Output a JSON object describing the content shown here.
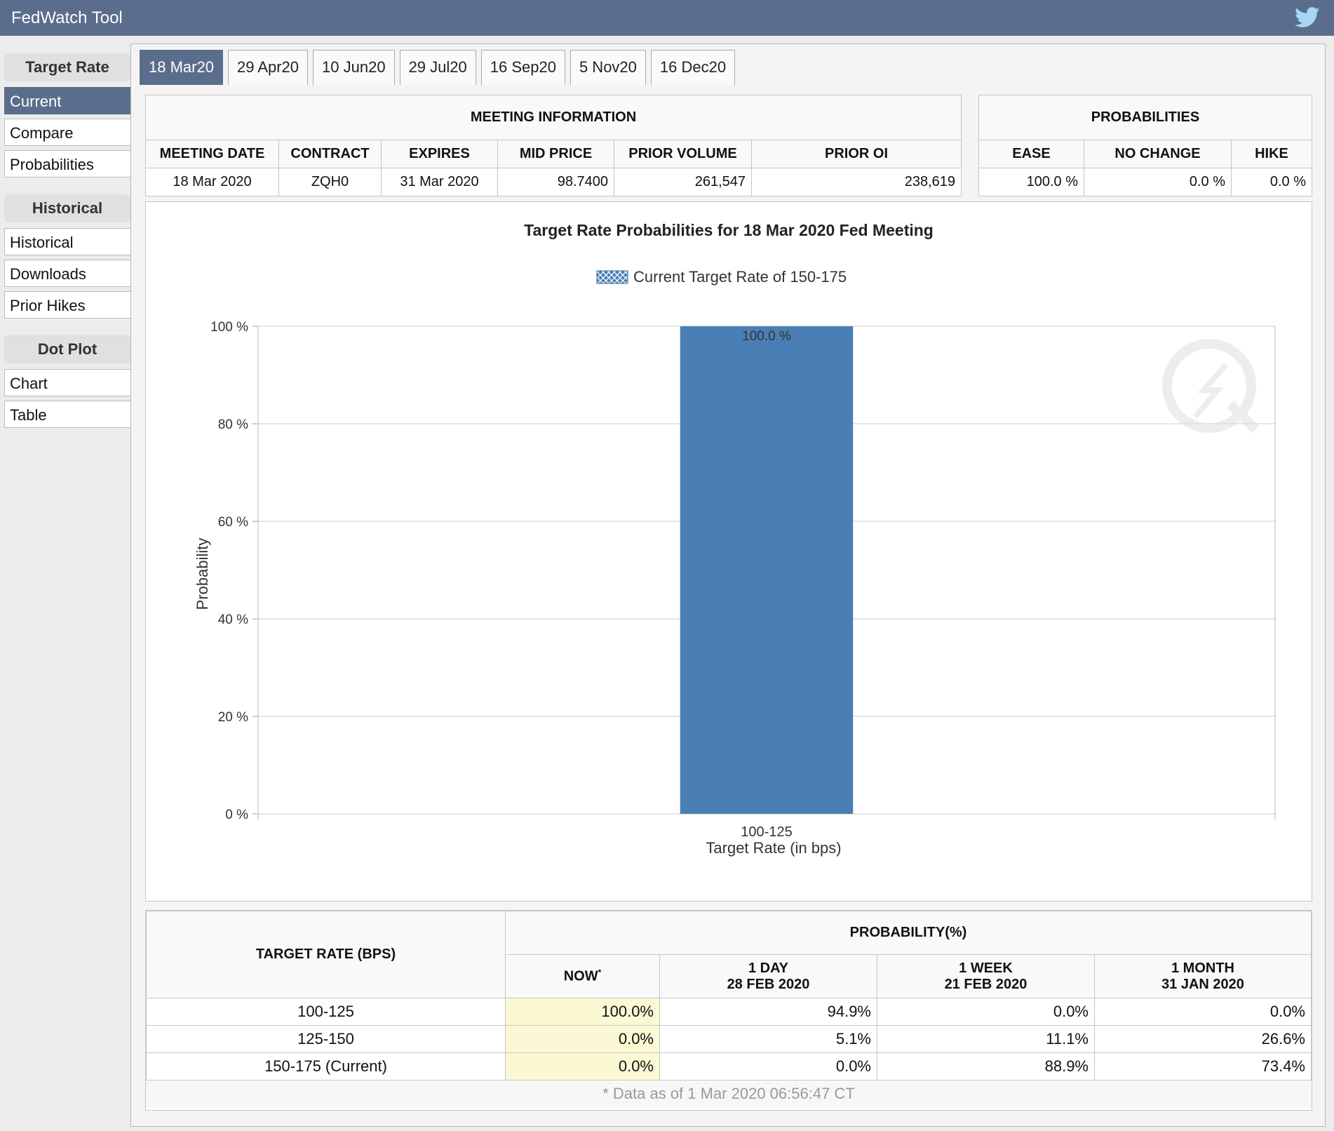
{
  "app": {
    "title": "FedWatch Tool",
    "twitter_icon": "twitter-icon"
  },
  "sidebar": {
    "sections": [
      {
        "header": "Target Rate",
        "items": [
          {
            "label": "Current",
            "active": true
          },
          {
            "label": "Compare",
            "active": false
          },
          {
            "label": "Probabilities",
            "active": false
          }
        ]
      },
      {
        "header": "Historical",
        "items": [
          {
            "label": "Historical",
            "active": false
          },
          {
            "label": "Downloads",
            "active": false
          },
          {
            "label": "Prior Hikes",
            "active": false
          }
        ]
      },
      {
        "header": "Dot Plot",
        "items": [
          {
            "label": "Chart",
            "active": false
          },
          {
            "label": "Table",
            "active": false
          }
        ]
      }
    ]
  },
  "tabs": [
    {
      "label": "18 Mar20",
      "active": true
    },
    {
      "label": "29 Apr20",
      "active": false
    },
    {
      "label": "10 Jun20",
      "active": false
    },
    {
      "label": "29 Jul20",
      "active": false
    },
    {
      "label": "16 Sep20",
      "active": false
    },
    {
      "label": "5 Nov20",
      "active": false
    },
    {
      "label": "16 Dec20",
      "active": false
    }
  ],
  "meeting_info": {
    "caption": "MEETING INFORMATION",
    "headers": [
      "MEETING DATE",
      "CONTRACT",
      "EXPIRES",
      "MID PRICE",
      "PRIOR VOLUME",
      "PRIOR OI"
    ],
    "row": [
      "18 Mar 2020",
      "ZQH0",
      "31 Mar 2020",
      "98.7400",
      "261,547",
      "238,619"
    ]
  },
  "probabilities": {
    "caption": "PROBABILITIES",
    "headers": [
      "EASE",
      "NO CHANGE",
      "HIKE"
    ],
    "row": [
      "100.0 %",
      "0.0 %",
      "0.0 %"
    ]
  },
  "chart_data": {
    "type": "bar",
    "title": "Target Rate Probabilities for 18 Mar 2020 Fed Meeting",
    "legend": "Current Target Rate of 150-175",
    "legend_position": "top",
    "xlabel": "Target Rate (in bps)",
    "ylabel": "Probability",
    "categories": [
      "100-125"
    ],
    "values": [
      100.0
    ],
    "value_labels": [
      "100.0 %"
    ],
    "ylim": [
      0,
      100
    ],
    "yticks": [
      "0 %",
      "20 %",
      "40 %",
      "60 %",
      "80 %",
      "100 %"
    ],
    "bar_color": "#4a7fb5",
    "grid": true
  },
  "rate_table": {
    "col_header": "TARGET RATE (BPS)",
    "prob_header": "PROBABILITY(%)",
    "now_label": "NOW",
    "now_mark": "*",
    "periods": [
      {
        "label": "1 DAY",
        "date": "28 FEB 2020"
      },
      {
        "label": "1 WEEK",
        "date": "21 FEB 2020"
      },
      {
        "label": "1 MONTH",
        "date": "31 JAN 2020"
      }
    ],
    "rows": [
      {
        "rate": "100-125",
        "now": "100.0%",
        "day": "94.9%",
        "week": "0.0%",
        "month": "0.0%"
      },
      {
        "rate": "125-150",
        "now": "0.0%",
        "day": "5.1%",
        "week": "11.1%",
        "month": "26.6%"
      },
      {
        "rate": "150-175 (Current)",
        "now": "0.0%",
        "day": "0.0%",
        "week": "88.9%",
        "month": "73.4%"
      }
    ],
    "note": "* Data as of 1 Mar 2020 06:56:47 CT"
  }
}
